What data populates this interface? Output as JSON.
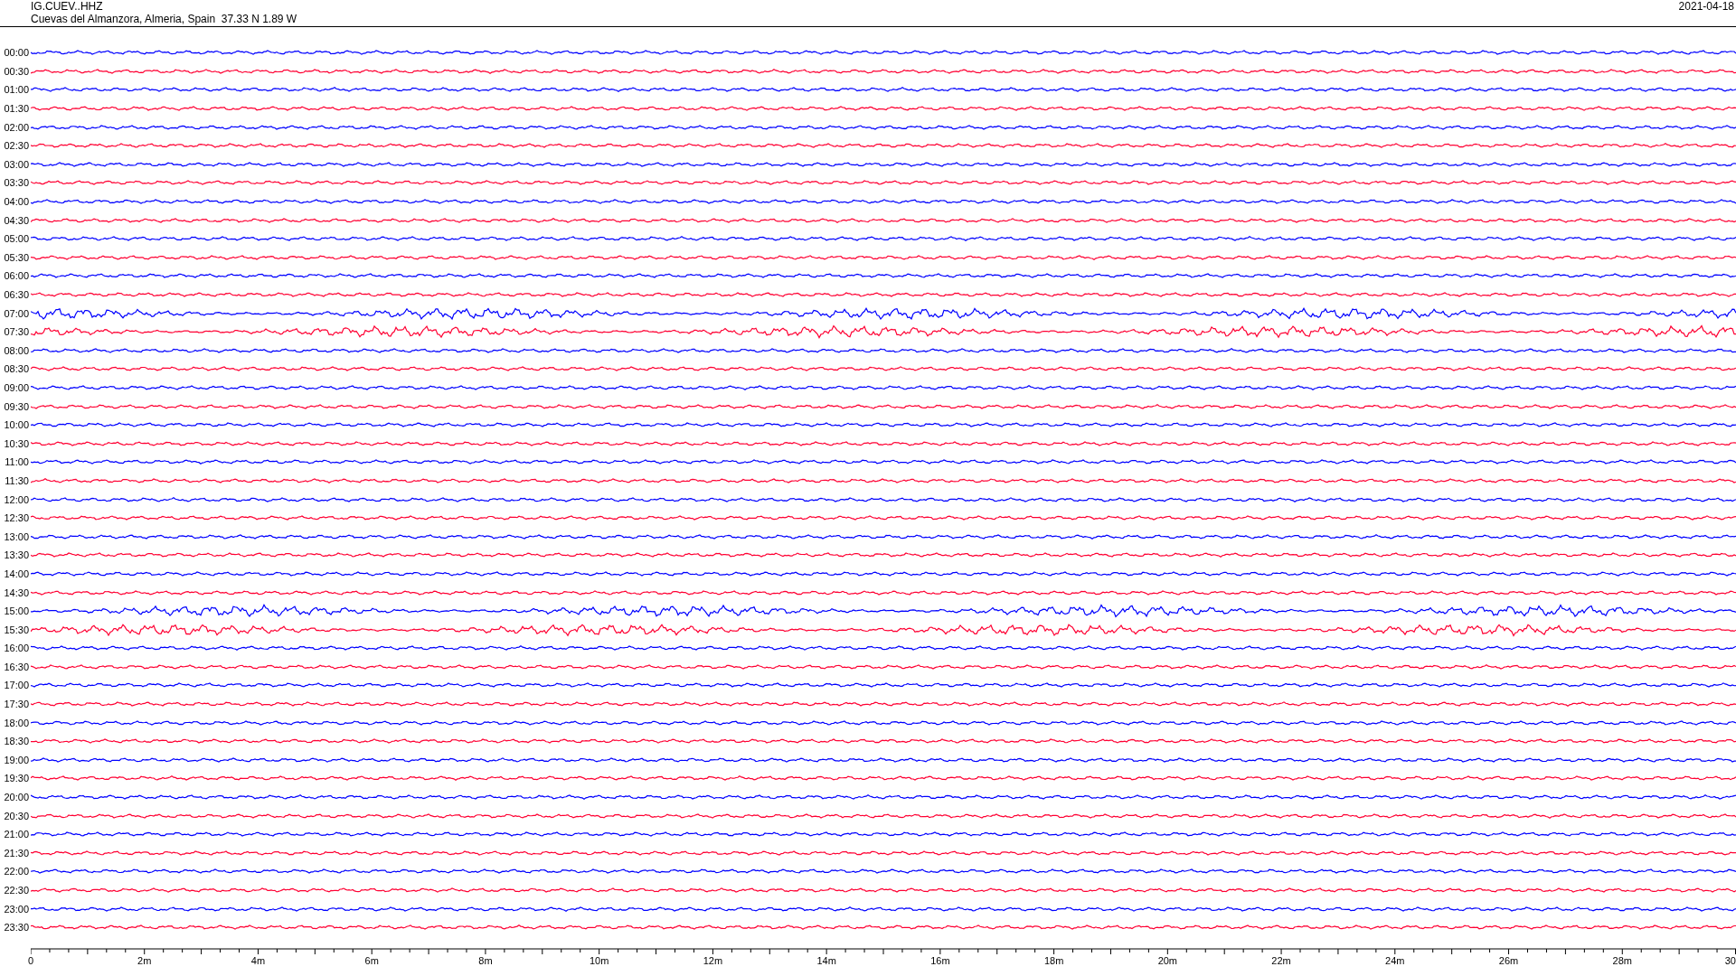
{
  "header": {
    "station": "IG.CUEV..HHZ",
    "location": "Cuevas del Almanzora, Almeria, Spain  37.33 N 1.89 W",
    "date": "2021-04-18"
  },
  "traces": [
    {
      "time": "00:00",
      "color": "#0000ff",
      "kind": "quiet"
    },
    {
      "time": "00:30",
      "color": "#ff0033",
      "kind": "quiet"
    },
    {
      "time": "01:00",
      "color": "#0000ff",
      "kind": "quiet"
    },
    {
      "time": "01:30",
      "color": "#ff0033",
      "kind": "quiet"
    },
    {
      "time": "02:00",
      "color": "#0000ff",
      "kind": "quiet"
    },
    {
      "time": "02:30",
      "color": "#ff0033",
      "kind": "quiet"
    },
    {
      "time": "03:00",
      "color": "#0000ff",
      "kind": "quiet"
    },
    {
      "time": "03:30",
      "color": "#ff0033",
      "kind": "quiet"
    },
    {
      "time": "04:00",
      "color": "#0000ff",
      "kind": "quiet"
    },
    {
      "time": "04:30",
      "color": "#ff0033",
      "kind": "quiet"
    },
    {
      "time": "05:00",
      "color": "#0000ff",
      "kind": "quiet"
    },
    {
      "time": "05:30",
      "color": "#ff0033",
      "kind": "quiet"
    },
    {
      "time": "06:00",
      "color": "#0000ff",
      "kind": "quiet"
    },
    {
      "time": "06:30",
      "color": "#ff0033",
      "kind": "quiet"
    },
    {
      "time": "07:00",
      "color": "#0000ff",
      "kind": "active"
    },
    {
      "time": "07:30",
      "color": "#ff0033",
      "kind": "active"
    },
    {
      "time": "08:00",
      "color": "#0000ff",
      "kind": "quiet"
    },
    {
      "time": "08:30",
      "color": "#ff0033",
      "kind": "quiet"
    },
    {
      "time": "09:00",
      "color": "#0000ff",
      "kind": "quiet"
    },
    {
      "time": "09:30",
      "color": "#ff0033",
      "kind": "quiet"
    },
    {
      "time": "10:00",
      "color": "#0000ff",
      "kind": "quiet"
    },
    {
      "time": "10:30",
      "color": "#ff0033",
      "kind": "quiet"
    },
    {
      "time": "11:00",
      "color": "#0000ff",
      "kind": "quiet"
    },
    {
      "time": "11:30",
      "color": "#ff0033",
      "kind": "quiet"
    },
    {
      "time": "12:00",
      "color": "#0000ff",
      "kind": "quiet"
    },
    {
      "time": "12:30",
      "color": "#ff0033",
      "kind": "quiet"
    },
    {
      "time": "13:00",
      "color": "#0000ff",
      "kind": "quiet"
    },
    {
      "time": "13:30",
      "color": "#ff0033",
      "kind": "quiet"
    },
    {
      "time": "14:00",
      "color": "#0000ff",
      "kind": "quiet"
    },
    {
      "time": "14:30",
      "color": "#ff0033",
      "kind": "quiet"
    },
    {
      "time": "15:00",
      "color": "#0000ff",
      "kind": "active"
    },
    {
      "time": "15:30",
      "color": "#ff0033",
      "kind": "active"
    },
    {
      "time": "16:00",
      "color": "#0000ff",
      "kind": "quiet"
    },
    {
      "time": "16:30",
      "color": "#ff0033",
      "kind": "quiet"
    },
    {
      "time": "17:00",
      "color": "#0000ff",
      "kind": "quiet"
    },
    {
      "time": "17:30",
      "color": "#ff0033",
      "kind": "quiet"
    },
    {
      "time": "18:00",
      "color": "#0000ff",
      "kind": "quiet"
    },
    {
      "time": "18:30",
      "color": "#ff0033",
      "kind": "quiet"
    },
    {
      "time": "19:00",
      "color": "#0000ff",
      "kind": "quiet"
    },
    {
      "time": "19:30",
      "color": "#ff0033",
      "kind": "quiet"
    },
    {
      "time": "20:00",
      "color": "#0000ff",
      "kind": "quiet"
    },
    {
      "time": "20:30",
      "color": "#ff0033",
      "kind": "quiet"
    },
    {
      "time": "21:00",
      "color": "#0000ff",
      "kind": "quiet"
    },
    {
      "time": "21:30",
      "color": "#ff0033",
      "kind": "quiet"
    },
    {
      "time": "22:00",
      "color": "#0000ff",
      "kind": "quiet"
    },
    {
      "time": "22:30",
      "color": "#ff0033",
      "kind": "quiet"
    },
    {
      "time": "23:00",
      "color": "#0000ff",
      "kind": "quiet"
    },
    {
      "time": "23:30",
      "color": "#ff0033",
      "kind": "quiet"
    }
  ],
  "x_axis": {
    "labels": [
      "0",
      "2m",
      "4m",
      "6m",
      "8m",
      "10m",
      "12m",
      "14m",
      "16m",
      "18m",
      "20m",
      "22m",
      "24m",
      "26m",
      "28m",
      "30"
    ]
  }
}
